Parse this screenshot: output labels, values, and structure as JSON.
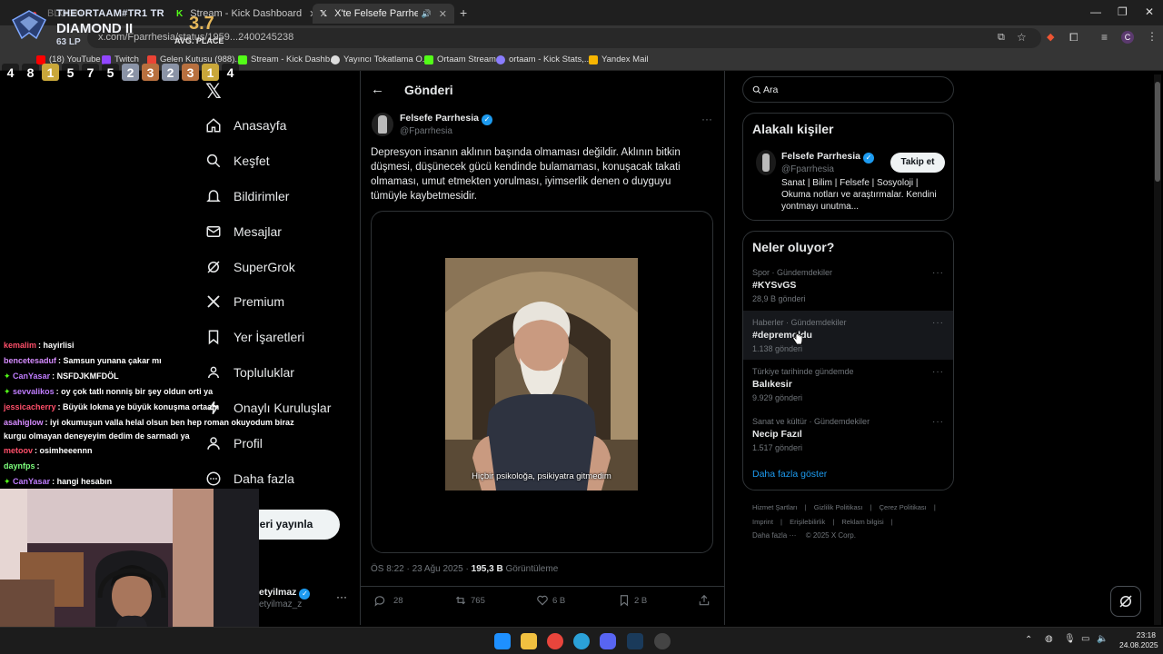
{
  "browser": {
    "tabs": [
      {
        "label": "BLOON"
      },
      {
        "label": "Stream - Kick Dashboard"
      },
      {
        "label": "X'te Felsefe Parrhesia: \"Dep"
      }
    ],
    "url": "x.com/Fparrhesia/status/1959...2400245238",
    "bookmarks": [
      "(18) YouTube",
      "Twitch",
      "Gelen Kutusu (988)...",
      "Stream - Kick Dashb...",
      "Yayıncı Tokatlama O...",
      "Ortaam Stream",
      "ortaam - Kick Stats,...",
      "Yandex Mail"
    ]
  },
  "overlay": {
    "player": "THEORTAAM#TR1 TR",
    "rank": "DIAMOND II",
    "lp": "63 LP",
    "avg_value": "3.7",
    "avg_label": "AVG. PLACE",
    "placements": [
      "4",
      "8",
      "1",
      "5",
      "7",
      "5",
      "2",
      "3",
      "2",
      "3",
      "1",
      "4"
    ]
  },
  "nav": {
    "items": [
      "Anasayfa",
      "Keşfet",
      "Bildirimler",
      "Mesajlar",
      "SuperGrok",
      "Premium",
      "Yer İşaretleri",
      "Topluluklar",
      "Onaylı Kuruluşlar",
      "Profil",
      "Daha fazla"
    ],
    "post_button": "eri yayınla",
    "account_name": "etyilmaz",
    "account_handle": "etyilmaz_z"
  },
  "post": {
    "header": "Gönderi",
    "author": "Felsefe Parrhesia",
    "handle": "@Fparrhesia",
    "text": "Depresyon insanın aklının başında olmaması değildir. Aklının bitkin düşmesi, düşünecek gücü kendinde bulamaması, konuşacak takati olmaması, umut etmekten yorulması, iyimserlik denen o duyguyu tümüyle kaybetmesidir.",
    "video_caption": "Hiçbir psikoloğa, psikiyatra gitmedim",
    "timestamp": "ÖS 8:22 · 23 Ağu 2025 · ",
    "views_count": "195,3 B",
    "views_label": "Görüntüleme",
    "stats": {
      "replies": "28",
      "reposts": "765",
      "likes": "6 B",
      "bookmarks": "2 B"
    }
  },
  "sidebar": {
    "search_placeholder": "Ara",
    "related_title": "Alakalı kişiler",
    "related": {
      "name": "Felsefe Parrhesia",
      "handle": "@Fparrhesia",
      "bio": "Sanat | Bilim | Felsefe | Sosyoloji | Okuma notları ve araştırmalar. Kendini yontmayı unutma...",
      "follow": "Takip et"
    },
    "trends_title": "Neler oluyor?",
    "trends": [
      {
        "category": "Spor · Gündemdekiler",
        "title": "#KYSvGS",
        "count": "28,9 B gönderi"
      },
      {
        "category": "Haberler · Gündemdekiler",
        "title": "#depremoldu",
        "count": "1.138 gönderi"
      },
      {
        "category": "Türkiye tarihinde gündemde",
        "title": "Balıkesir",
        "count": "9.929 gönderi"
      },
      {
        "category": "Sanat ve kültür · Gündemdekiler",
        "title": "Necip Fazıl",
        "count": "1.517 gönderi"
      }
    ],
    "show_more": "Daha fazla göster",
    "footer_row1": [
      "Hizmet Şartları",
      "Gizlilik Politikası",
      "Çerez Politikası"
    ],
    "footer_row2": [
      "Imprint",
      "Erişilebilirlik",
      "Reklam bilgisi"
    ],
    "footer_more": "Daha fazla ···",
    "copyright": "© 2025 X Corp."
  },
  "chat": [
    {
      "user": "kemalim",
      "msg": ": hayirlisi",
      "color": "#ff4f6a",
      "badge": false
    },
    {
      "user": "bencetesaduf",
      "msg": ": Samsun yunana çakar mı",
      "color": "#d68cff",
      "badge": false
    },
    {
      "user": "CanYasar",
      "msg": ": NSFDJKMFDÖL",
      "color": "#c07dff",
      "badge": true
    },
    {
      "user": "sevvalikos",
      "msg": ": oy çok tatlı nonniş bir şey oldun orti ya",
      "color": "#c07dff",
      "badge": true
    },
    {
      "user": "jessicacherry",
      "msg": ": Büyük lokma ye büyük konuşma ortaam",
      "color": "#ff4f6a",
      "badge": false
    },
    {
      "user": "asahiglow",
      "msg": ": iyi okumuşun valla helal olsun ben hep roman okuyodum biraz",
      "color": "#d68cff",
      "badge": false
    },
    {
      "user": "",
      "msg": "kurgu olmayan deneyeyim dedim de sarmadı ya",
      "color": "#d68cff",
      "badge": false
    },
    {
      "user": "metoov",
      "msg": ": osimheeennn",
      "color": "#ff4f6a",
      "badge": false
    },
    {
      "user": "daynfps",
      "msg": ":",
      "color": "#7dff7d",
      "badge": false
    },
    {
      "user": "CanYasar",
      "msg": ": hangi hesabın",
      "color": "#c07dff",
      "badge": true
    }
  ],
  "taskbar": {
    "time": "23:18",
    "date": "24.08.2025"
  }
}
